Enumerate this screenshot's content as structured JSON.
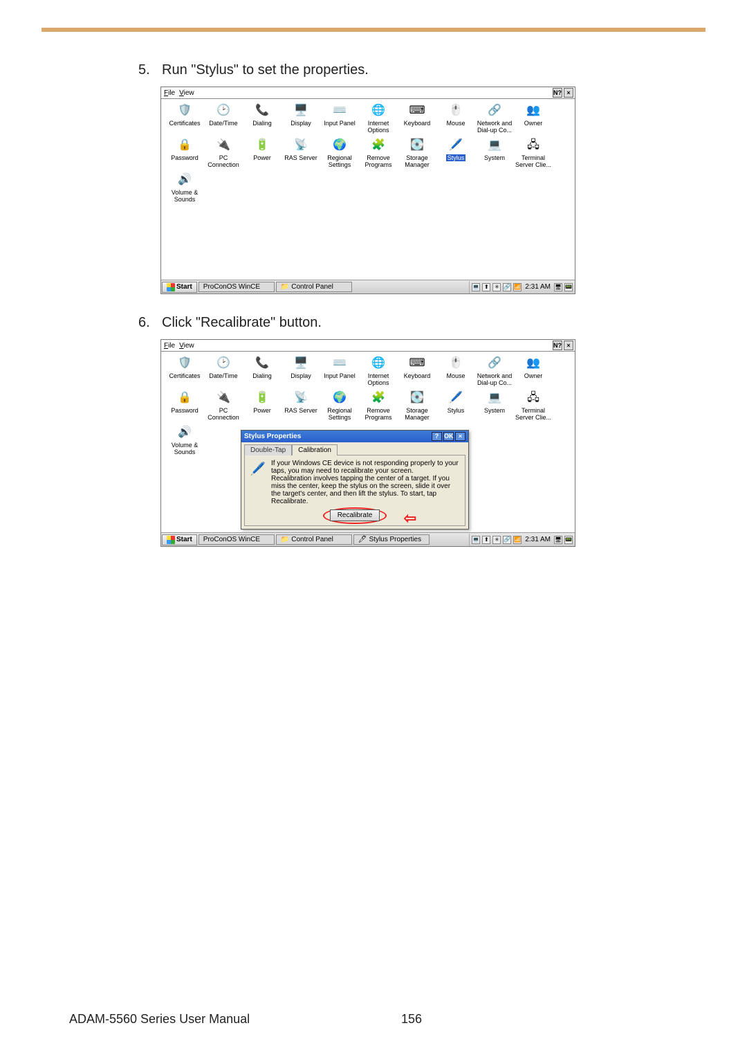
{
  "steps": {
    "s5": {
      "num": "5.",
      "text": "Run \"Stylus\" to set the properties."
    },
    "s6": {
      "num": "6.",
      "text": "Click \"Recalibrate\" button."
    }
  },
  "menu": {
    "file": "File",
    "file_u": "F",
    "view": "View",
    "view_u": "V"
  },
  "titlebtns": {
    "help": "N?",
    "close": "×"
  },
  "icons": [
    {
      "label": "Certificates",
      "glyph": "🛡️"
    },
    {
      "label": "Date/Time",
      "glyph": "🕑"
    },
    {
      "label": "Dialing",
      "glyph": "📞"
    },
    {
      "label": "Display",
      "glyph": "🖥️"
    },
    {
      "label": "Input Panel",
      "glyph": "⌨️"
    },
    {
      "label": "Internet Options",
      "glyph": "🌐"
    },
    {
      "label": "Keyboard",
      "glyph": "⌨"
    },
    {
      "label": "Mouse",
      "glyph": "🖱️"
    },
    {
      "label": "Network and Dial-up Co...",
      "glyph": "🔗"
    },
    {
      "label": "Owner",
      "glyph": "👥"
    },
    {
      "label": "Password",
      "glyph": "🔒"
    },
    {
      "label": "PC Connection",
      "glyph": "🔌"
    },
    {
      "label": "Power",
      "glyph": "🔋"
    },
    {
      "label": "RAS Server",
      "glyph": "📡"
    },
    {
      "label": "Regional Settings",
      "glyph": "🌍"
    },
    {
      "label": "Remove Programs",
      "glyph": "🧩"
    },
    {
      "label": "Storage Manager",
      "glyph": "💽"
    },
    {
      "label": "Stylus",
      "glyph": "🖊️"
    },
    {
      "label": "System",
      "glyph": "💻"
    },
    {
      "label": "Terminal Server Clie...",
      "glyph": "🖧"
    },
    {
      "label": "Volume & Sounds",
      "glyph": "🔊"
    }
  ],
  "taskbar": {
    "start": "Start",
    "btn1": "ProConOS WinCE",
    "btn2": "Control Panel",
    "btn3": "Stylus Properties",
    "time": "2:31 AM"
  },
  "dialog": {
    "title": "Stylus Properties",
    "tab1": "Double-Tap",
    "tab2": "Calibration",
    "body": "If your Windows CE device is not responding properly to your taps, you may need to recalibrate your screen.\nRecalibration involves tapping the center of a target. If you miss the center, keep the stylus on the screen, slide it over the target's center, and then lift the stylus. To start, tap Recalibrate.",
    "btn": "Recalibrate",
    "help": "?",
    "ok": "OK",
    "close": "×"
  },
  "footer": {
    "manual": "ADAM-5560 Series User Manual",
    "page": "156"
  }
}
